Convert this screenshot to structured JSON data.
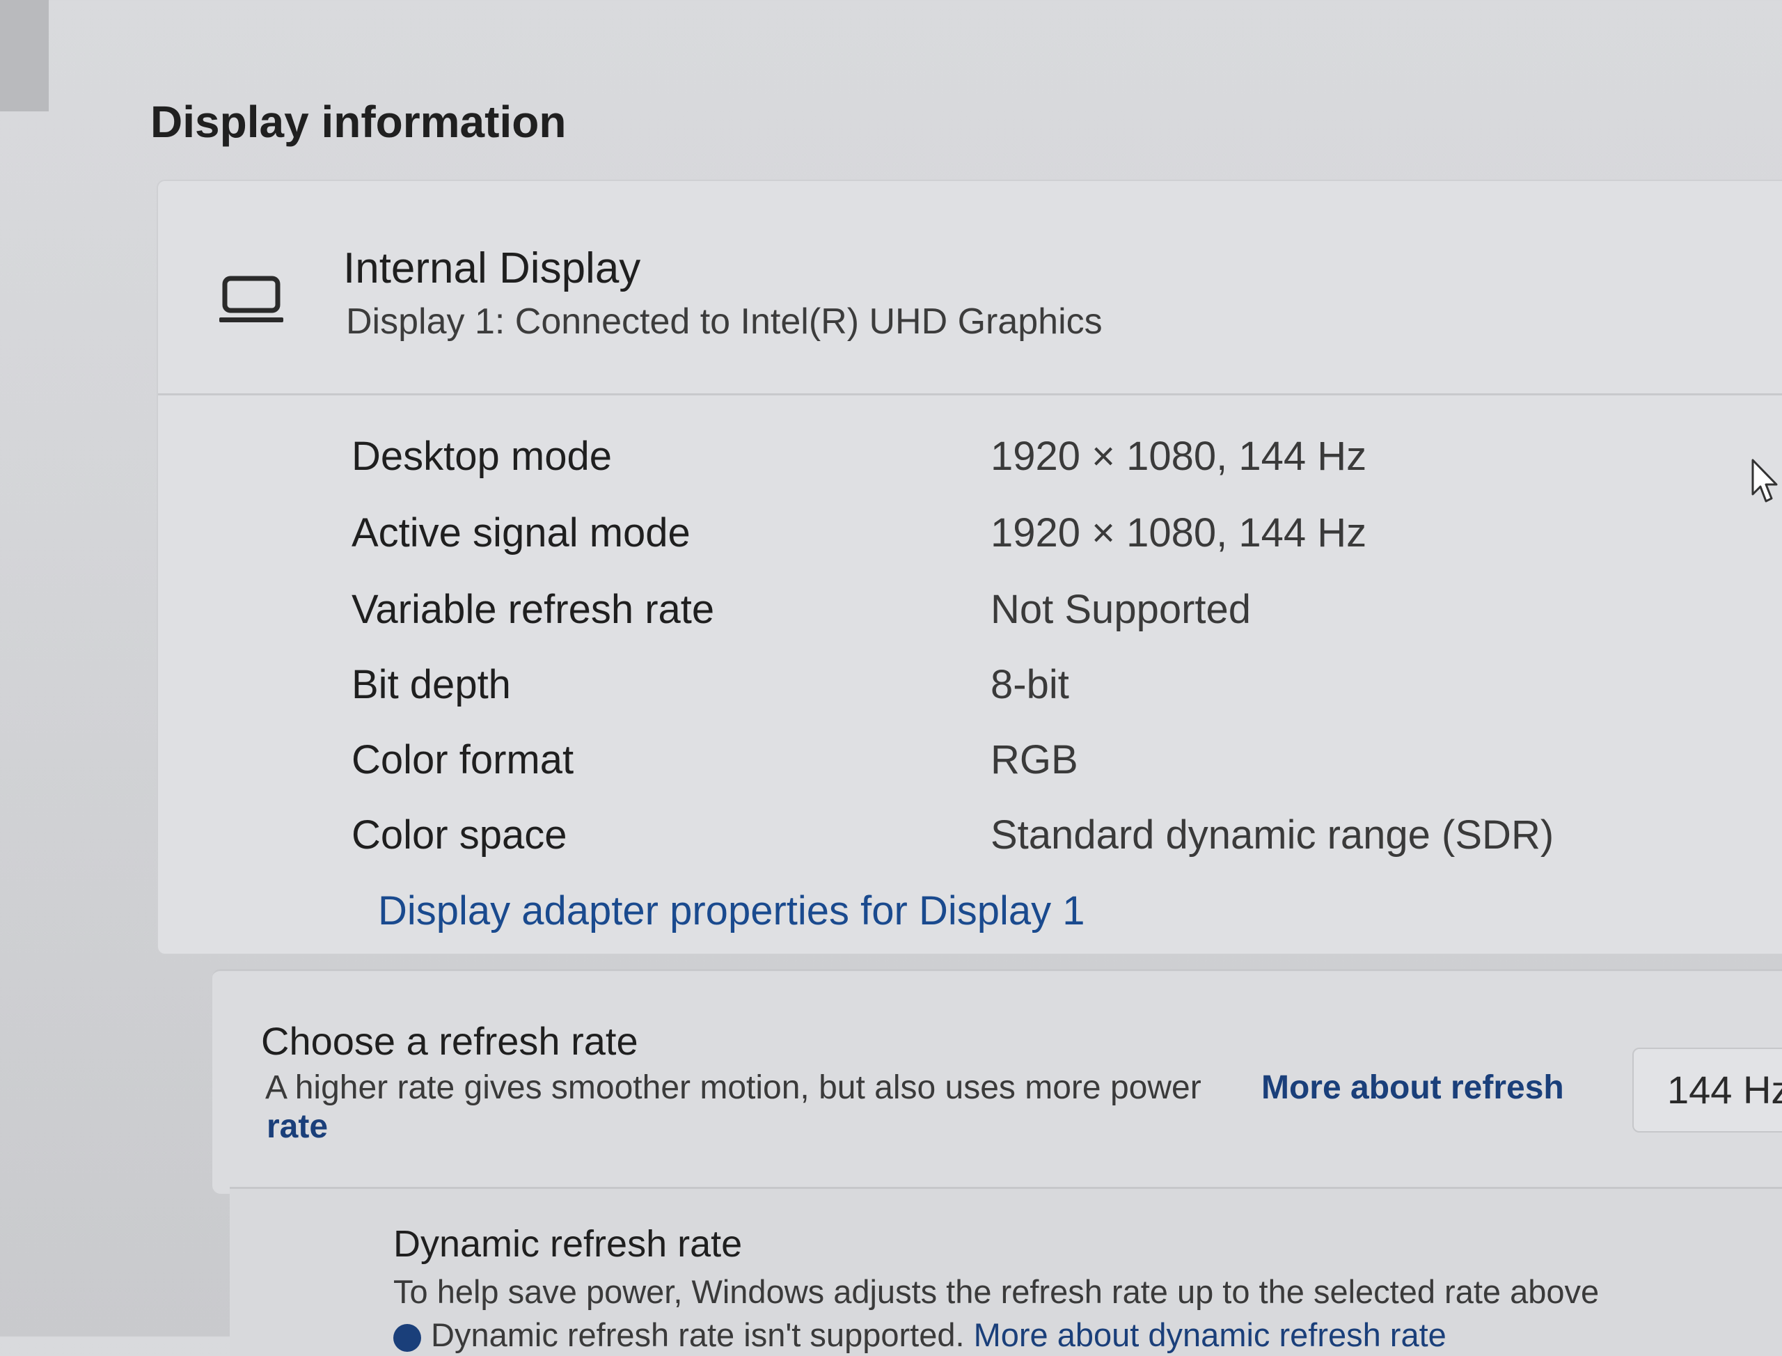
{
  "section": {
    "title": "Display information"
  },
  "display": {
    "icon": "laptop-icon",
    "name": "Internal Display",
    "subtitle": "Display 1: Connected to Intel(R) UHD Graphics"
  },
  "info": {
    "rows": [
      {
        "label": "Desktop mode",
        "value": "1920 × 1080, 144 Hz"
      },
      {
        "label": "Active signal mode",
        "value": "1920 × 1080, 144 Hz"
      },
      {
        "label": "Variable refresh rate",
        "value": "Not Supported"
      },
      {
        "label": "Bit depth",
        "value": "8-bit"
      },
      {
        "label": "Color format",
        "value": "RGB"
      },
      {
        "label": "Color space",
        "value": "Standard dynamic range (SDR)"
      }
    ],
    "adapter_link": "Display adapter properties for Display 1"
  },
  "refresh": {
    "title": "Choose a refresh rate",
    "description": "A higher rate gives smoother motion, but also uses more power",
    "link_part1": "More about refresh",
    "link_part2": "rate",
    "selected": "144 Hz"
  },
  "dynamic": {
    "title": "Dynamic refresh rate",
    "description": "To help save power, Windows adjusts the refresh rate up to the selected rate above",
    "note": "Dynamic refresh rate isn't supported.",
    "note_link": "More about dynamic refresh rate"
  },
  "colors": {
    "link": "#1a4a8e",
    "background": "#d9dadd",
    "card": "#dfe0e3"
  }
}
